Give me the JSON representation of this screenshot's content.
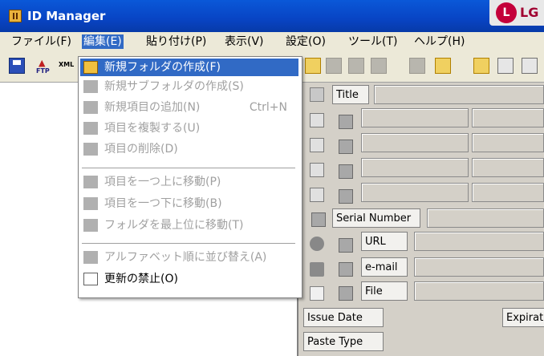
{
  "window": {
    "title": "ID Manager",
    "logo_letters": "L",
    "logo_text": "LG"
  },
  "menubar": {
    "items": [
      {
        "label": "ファイル(F)"
      },
      {
        "label": "編集(E)"
      },
      {
        "label": "貼り付け(P)"
      },
      {
        "label": "表示(V)"
      },
      {
        "label": "設定(O)"
      },
      {
        "label": "ツール(T)"
      },
      {
        "label": "ヘルプ(H)"
      }
    ]
  },
  "toolbar": {
    "ftp_label": "FTP",
    "xml_label": "XML"
  },
  "edit_menu": {
    "items": [
      {
        "label": "新規フォルダの作成(F)"
      },
      {
        "label": "新規サブフォルダの作成(S)"
      },
      {
        "label": "新規項目の追加(N)",
        "shortcut": "Ctrl+N"
      },
      {
        "label": "項目を複製する(U)"
      },
      {
        "label": "項目の削除(D)"
      },
      {
        "label": "項目を一つ上に移動(P)"
      },
      {
        "label": "項目を一つ下に移動(B)"
      },
      {
        "label": "フォルダを最上位に移動(T)"
      },
      {
        "label": "アルファベット順に並び替え(A)"
      },
      {
        "label": "更新の禁止(O)"
      }
    ]
  },
  "detail": {
    "title_label": "Title",
    "serial_label": "Serial Number",
    "url_label": "URL",
    "email_label": "e-mail",
    "file_label": "File",
    "issue_label": "Issue Date",
    "expiration_label": "Expirat",
    "paste_label": "Paste Type"
  },
  "colors": {
    "title_bar": "#0a58d8",
    "highlight": "#316ac5",
    "logo": "#c4003a"
  }
}
